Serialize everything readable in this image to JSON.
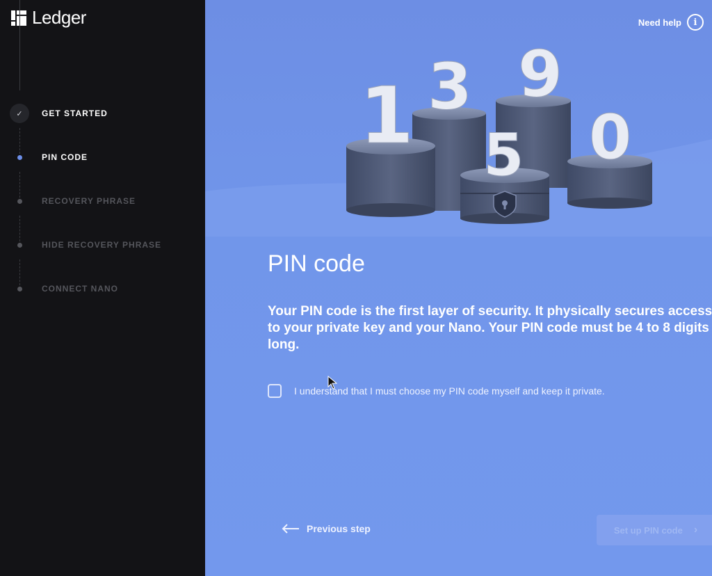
{
  "app": {
    "brand": "Ledger",
    "logo_icon": "ledger-logo-icon"
  },
  "sidebar": {
    "steps": [
      {
        "label": "GET STARTED",
        "state": "done",
        "icon": "check-icon"
      },
      {
        "label": "PIN CODE",
        "state": "active"
      },
      {
        "label": "RECOVERY PHRASE",
        "state": "pending"
      },
      {
        "label": "HIDE RECOVERY PHRASE",
        "state": "pending"
      },
      {
        "label": "CONNECT NANO",
        "state": "pending"
      }
    ]
  },
  "header": {
    "help_label": "Need help",
    "help_icon": "info-icon"
  },
  "illustration": {
    "digits": [
      "1",
      "3",
      "9",
      "5",
      "0"
    ],
    "icon": "shield-lock-icon"
  },
  "main": {
    "title": "PIN code",
    "description": "Your PIN code is the first layer of security. It physically secures access to your private key and your Nano. Your PIN code must be 4 to 8 digits long.",
    "checkbox_label": "I understand that I must choose my PIN code myself and keep it private.",
    "checkbox_checked": false
  },
  "footer": {
    "previous_label": "Previous step",
    "next_label": "Set up PIN code",
    "next_enabled": false
  },
  "colors": {
    "sidebar_bg": "#131316",
    "main_bg": "#7196ea",
    "active_dot": "#6c8ee8"
  }
}
